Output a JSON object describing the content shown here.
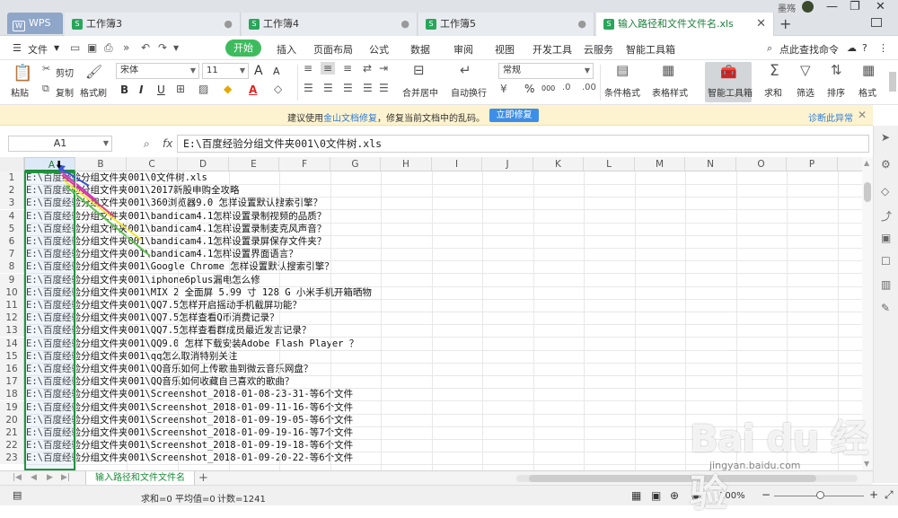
{
  "tabs": {
    "wps": "WPS",
    "items": [
      {
        "label": "工作簿3",
        "state": "dirty"
      },
      {
        "label": "工作簿4",
        "state": "dirty"
      },
      {
        "label": "工作簿5",
        "state": "dirty"
      },
      {
        "label": "输入路径和文件文件名.xls",
        "state": "active"
      }
    ],
    "new_tab": "+",
    "user": "墨殇"
  },
  "menubar": {
    "file": "文件",
    "items": [
      "开始",
      "插入",
      "页面布局",
      "公式",
      "数据",
      "审阅",
      "视图",
      "开发工具",
      "云服务",
      "智能工具箱"
    ],
    "search": "点此查找命令"
  },
  "ribbon": {
    "paste": "粘贴",
    "cut": "剪切",
    "copy": "复制",
    "format_painter": "格式刷",
    "font": "宋体",
    "font_size": "11",
    "merge_center": "合并居中",
    "auto_wrap": "自动换行",
    "number_format": "常规",
    "cond_format": "条件格式",
    "table_style": "表格样式",
    "smart_toolbox": "智能工具箱",
    "sum": "求和",
    "filter": "筛选",
    "sort": "排序",
    "format": "格式",
    "bold": "B",
    "italic": "I",
    "underline": "U",
    "font_grow": "A",
    "font_shrink": "A",
    "percent": "%",
    "thousands": "000"
  },
  "infobar": {
    "text1": "建议使用",
    "link": "金山文档修复",
    "text2": "，修复当前文档中的乱码。",
    "button": "立即修复",
    "diagnose": "诊断此异常"
  },
  "formula": {
    "cell_ref": "A1",
    "fx": "fx",
    "value": "E:\\百度经验分组文件夹001\\0文件树.xls"
  },
  "columns": [
    "A",
    "B",
    "C",
    "D",
    "E",
    "F",
    "G",
    "H",
    "I",
    "J",
    "K",
    "L",
    "M",
    "N",
    "O",
    "P"
  ],
  "rows": [
    {
      "n": "1",
      "text": "E:\\百度经验分组文件夹001\\0文件树.xls"
    },
    {
      "n": "2",
      "text": "E:\\百度经验分组文件夹001\\2017新股申购全攻略"
    },
    {
      "n": "3",
      "text": "E:\\百度经验分组文件夹001\\360浏览器9.0 怎样设置默认搜索引擎？"
    },
    {
      "n": "4",
      "text": "E:\\百度经验分组文件夹001\\bandicam4.1怎样设置录制视频的品质？"
    },
    {
      "n": "5",
      "text": "E:\\百度经验分组文件夹001\\bandicam4.1怎样设置录制麦克风声音？"
    },
    {
      "n": "6",
      "text": "E:\\百度经验分组文件夹001\\bandicam4.1怎样设置录屏保存文件夹？"
    },
    {
      "n": "7",
      "text": "E:\\百度经验分组文件夹001\\bandicam4.1怎样设置界面语言？"
    },
    {
      "n": "8",
      "text": "E:\\百度经验分组文件夹001\\Google Chrome 怎样设置默认搜索引擎？"
    },
    {
      "n": "9",
      "text": "E:\\百度经验分组文件夹001\\iphone6plus漏电怎么修"
    },
    {
      "n": "10",
      "text": "E:\\百度经验分组文件夹001\\MIX 2 全面屏 5.99 寸 128 G 小米手机开箱晒物"
    },
    {
      "n": "11",
      "text": "E:\\百度经验分组文件夹001\\QQ7.5怎样开启摇动手机截屏功能？"
    },
    {
      "n": "12",
      "text": "E:\\百度经验分组文件夹001\\QQ7.5怎样查看Q币消费记录？"
    },
    {
      "n": "13",
      "text": "E:\\百度经验分组文件夹001\\QQ7.5怎样查看群成员最近发言记录？"
    },
    {
      "n": "14",
      "text": "E:\\百度经验分组文件夹001\\QQ9.0 怎样下载安装Adobe Flash Player ？"
    },
    {
      "n": "15",
      "text": "E:\\百度经验分组文件夹001\\qq怎么取消特别关注"
    },
    {
      "n": "16",
      "text": "E:\\百度经验分组文件夹001\\QQ音乐如何上传歌曲到微云音乐网盘？"
    },
    {
      "n": "17",
      "text": "E:\\百度经验分组文件夹001\\QQ音乐如何收藏自己喜欢的歌曲？"
    },
    {
      "n": "18",
      "text": "E:\\百度经验分组文件夹001\\Screenshot_2018-01-08-23-31-等6个文件"
    },
    {
      "n": "19",
      "text": "E:\\百度经验分组文件夹001\\Screenshot_2018-01-09-11-16-等6个文件"
    },
    {
      "n": "20",
      "text": "E:\\百度经验分组文件夹001\\Screenshot_2018-01-09-19-05-等6个文件"
    },
    {
      "n": "21",
      "text": "E:\\百度经验分组文件夹001\\Screenshot_2018-01-09-19-16-等7个文件"
    },
    {
      "n": "22",
      "text": "E:\\百度经验分组文件夹001\\Screenshot_2018-01-09-19-18-等6个文件"
    },
    {
      "n": "23",
      "text": "E:\\百度经验分组文件夹001\\Screenshot_2018-01-09-20-22-等6个文件"
    }
  ],
  "sheet": {
    "name": "输入路径和文件文件名",
    "add": "+"
  },
  "status": {
    "sum": "求和=0",
    "avg": "平均值=0",
    "count": "计数=1241",
    "zoom": "100%"
  },
  "watermark": {
    "logo": "Bai du 经验",
    "url": "jingyan.baidu.com"
  },
  "icons": {
    "accent": "#3ebb5e",
    "selection": "#22943f",
    "info_bg": "#fdf3d0"
  }
}
